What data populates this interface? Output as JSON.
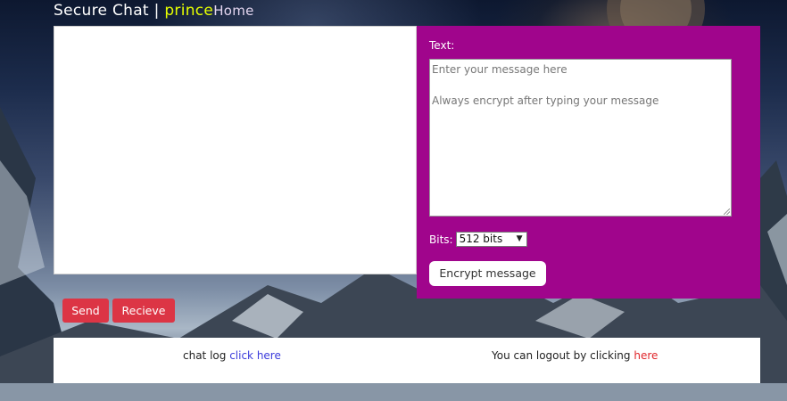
{
  "header": {
    "title": "Secure Chat | ",
    "username": "prince",
    "home_link": "Home"
  },
  "panel": {
    "text_label": "Text:",
    "message_placeholder_line1": "Enter your message here",
    "message_placeholder_line2": "Always encrypt after typing your message",
    "bits_label": "Bits:",
    "bits_selected": "512 bits",
    "encrypt_button": "Encrypt message"
  },
  "actions": {
    "send_label": "Send",
    "receive_label": "Recieve"
  },
  "footer": {
    "chat_log_text": "chat log ",
    "chat_log_link": "click here",
    "logout_text": "You can logout by clicking ",
    "logout_link": "here"
  },
  "colors": {
    "panel_bg": "#a0058c",
    "username": "#e6ff00",
    "button_red": "#dc3545",
    "link_blue": "#3b3bdb",
    "link_red": "#e0262b"
  }
}
